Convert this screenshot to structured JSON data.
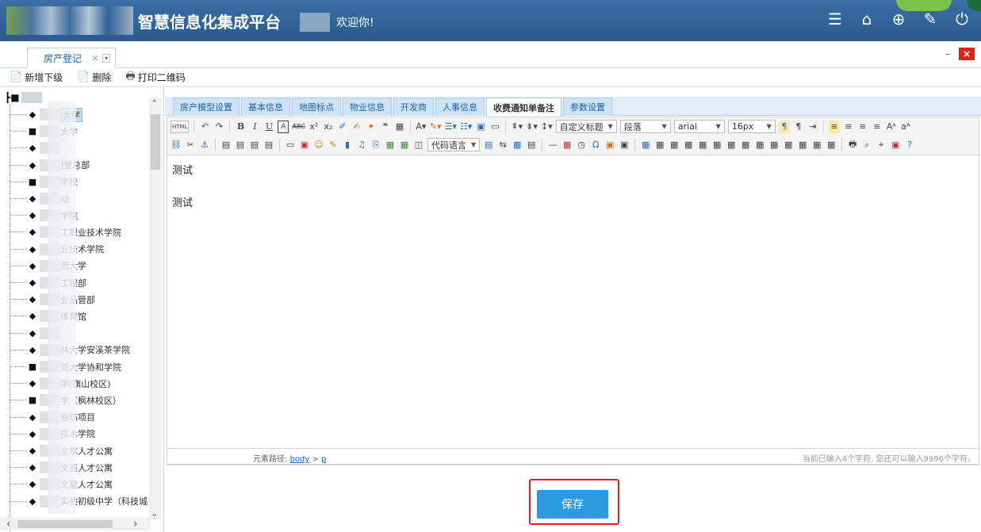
{
  "header": {
    "title": "智慧信息化集成平台",
    "welcome": "欢迎你!",
    "icons": [
      "menu-icon",
      "home-icon",
      "globe-icon",
      "edit-icon",
      "power-icon"
    ]
  },
  "tab": {
    "label": "房产登记",
    "close": "×",
    "menu": "▾"
  },
  "window": {
    "min": "–",
    "close": "×"
  },
  "actions": [
    {
      "label": "新增下级",
      "icon": "add-doc-icon"
    },
    {
      "label": "删除",
      "icon": "delete-icon"
    },
    {
      "label": "打印二维码",
      "icon": "print-icon"
    }
  ],
  "tree": {
    "items": [
      {
        "label": "大学",
        "selected": true,
        "icon": "leaf"
      },
      {
        "label": "大学",
        "selected": false,
        "icon": "folder"
      },
      {
        "label": "",
        "selected": false,
        "icon": "leaf"
      },
      {
        "label": "]登总部",
        "selected": false,
        "icon": "leaf"
      },
      {
        "label": "学校",
        "selected": false,
        "icon": "folder"
      },
      {
        "label": "动",
        "selected": false,
        "icon": "leaf"
      },
      {
        "label": "学院",
        "selected": false,
        "icon": "leaf"
      },
      {
        "label": "工职业技术学院",
        "selected": false,
        "icon": "leaf"
      },
      {
        "label": "业技术学院",
        "selected": false,
        "icon": "leaf"
      },
      {
        "label": "范大学",
        "selected": false,
        "icon": "leaf"
      },
      {
        "label": "工程部",
        "selected": false,
        "icon": "leaf"
      },
      {
        "label": "业品管部",
        "selected": false,
        "icon": "leaf"
      },
      {
        "label": "体育馆",
        "selected": false,
        "icon": "leaf"
      },
      {
        "label": "",
        "selected": false,
        "icon": "leaf"
      },
      {
        "label": "林大学安溪茶学院",
        "selected": false,
        "icon": "leaf"
      },
      {
        "label": "范大学协和学院",
        "selected": false,
        "icon": "folder"
      },
      {
        "label": "学(旗山校区)",
        "selected": false,
        "icon": "leaf"
      },
      {
        "label": "学（枫林校区）",
        "selected": false,
        "icon": "folder"
      },
      {
        "label": "业坊项目",
        "selected": false,
        "icon": "leaf"
      },
      {
        "label": "技术学院",
        "selected": false,
        "icon": "leaf"
      },
      {
        "label": "文萃人才公寓",
        "selected": false,
        "icon": "leaf"
      },
      {
        "label": "文荟人才公寓",
        "selected": false,
        "icon": "leaf"
      },
      {
        "label": "文星人才公寓",
        "selected": false,
        "icon": "leaf"
      },
      {
        "label": "实验初级中学（科技城",
        "selected": false,
        "icon": "leaf"
      }
    ]
  },
  "subtabs": [
    {
      "label": "房产模型设置",
      "active": false
    },
    {
      "label": "基本信息",
      "active": false
    },
    {
      "label": "地图标点",
      "active": false
    },
    {
      "label": "物业信息",
      "active": false
    },
    {
      "label": "开发商",
      "active": false
    },
    {
      "label": "人事信息",
      "active": false
    },
    {
      "label": "收费通知单备注",
      "active": true
    },
    {
      "label": "参数设置",
      "active": false
    }
  ],
  "editor": {
    "toolbar": {
      "html": "HTML",
      "heading_select": "自定义标题",
      "paragraph_select": "段落",
      "font_select": "arial",
      "size_select": "16px",
      "code_lang_select": "代码语言"
    },
    "content": [
      "测试",
      "测试"
    ],
    "path_label": "元素路径:",
    "path_body": "body",
    "path_sep": " > ",
    "path_p": "p",
    "char_count": "当前已输入4个字符, 您还可以输入9996个字符。"
  },
  "save_button": "保存",
  "colors": {
    "header": "#2a5a8e",
    "accent": "#2a9be0",
    "highlight": "#e8211f"
  }
}
